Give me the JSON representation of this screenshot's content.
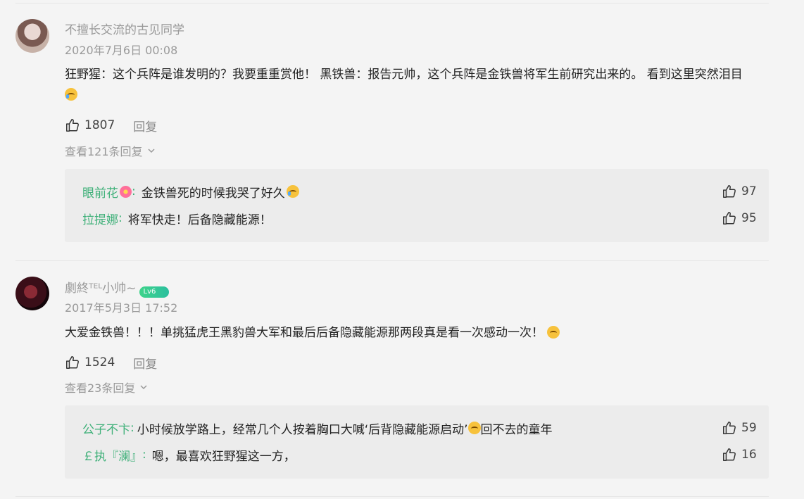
{
  "comments": [
    {
      "username": "不擅长交流的古见同学",
      "time": "2020年7月6日 00:08",
      "text": "狂野猩：这个兵阵是谁发明的？我要重重赏他！ 黑铁兽：报告元帅，这个兵阵是金铁兽将军生前研究出来的。 看到这里突然泪目",
      "likes": "1807",
      "reply_label": "回复",
      "view_replies": "查看121条回复",
      "replies": [
        {
          "name": "眼前花",
          "sep": ":",
          "text": "金铁兽死的时候我哭了好久",
          "likes": "97"
        },
        {
          "name": "拉提娜",
          "sep": ":",
          "text": "将军快走！后备隐藏能源！",
          "likes": "95"
        }
      ]
    },
    {
      "username": "劇終ᵀᴱᴸ小帅~",
      "badge": "Lv6",
      "time": "2017年5月3日 17:52",
      "text": "大爱金铁兽！！！单挑猛虎王黑豹兽大军和最后后备隐藏能源那两段真是看一次感动一次！",
      "likes": "1524",
      "reply_label": "回复",
      "view_replies": "查看23条回复",
      "replies": [
        {
          "name": "公子不卞",
          "sep": ":",
          "text": "小时候放学路上，经常几个人按着胸口大喊‘后背隐藏能源启动’",
          "text2": "回不去的童年",
          "likes": "59"
        },
        {
          "name": "￡执『澜』",
          "sep": ":",
          "text": "嗯，最喜欢狂野猩这一方，",
          "likes": "16"
        }
      ]
    }
  ],
  "colors": {
    "accent": "#3fb079",
    "background": "#f4f4f4",
    "reply_box": "#ececec"
  },
  "icons": [
    "thumbs-up-icon",
    "chevron-down-icon",
    "emoji-crying-icon",
    "emoji-laughing-icon",
    "flower-emoji-icon"
  ]
}
